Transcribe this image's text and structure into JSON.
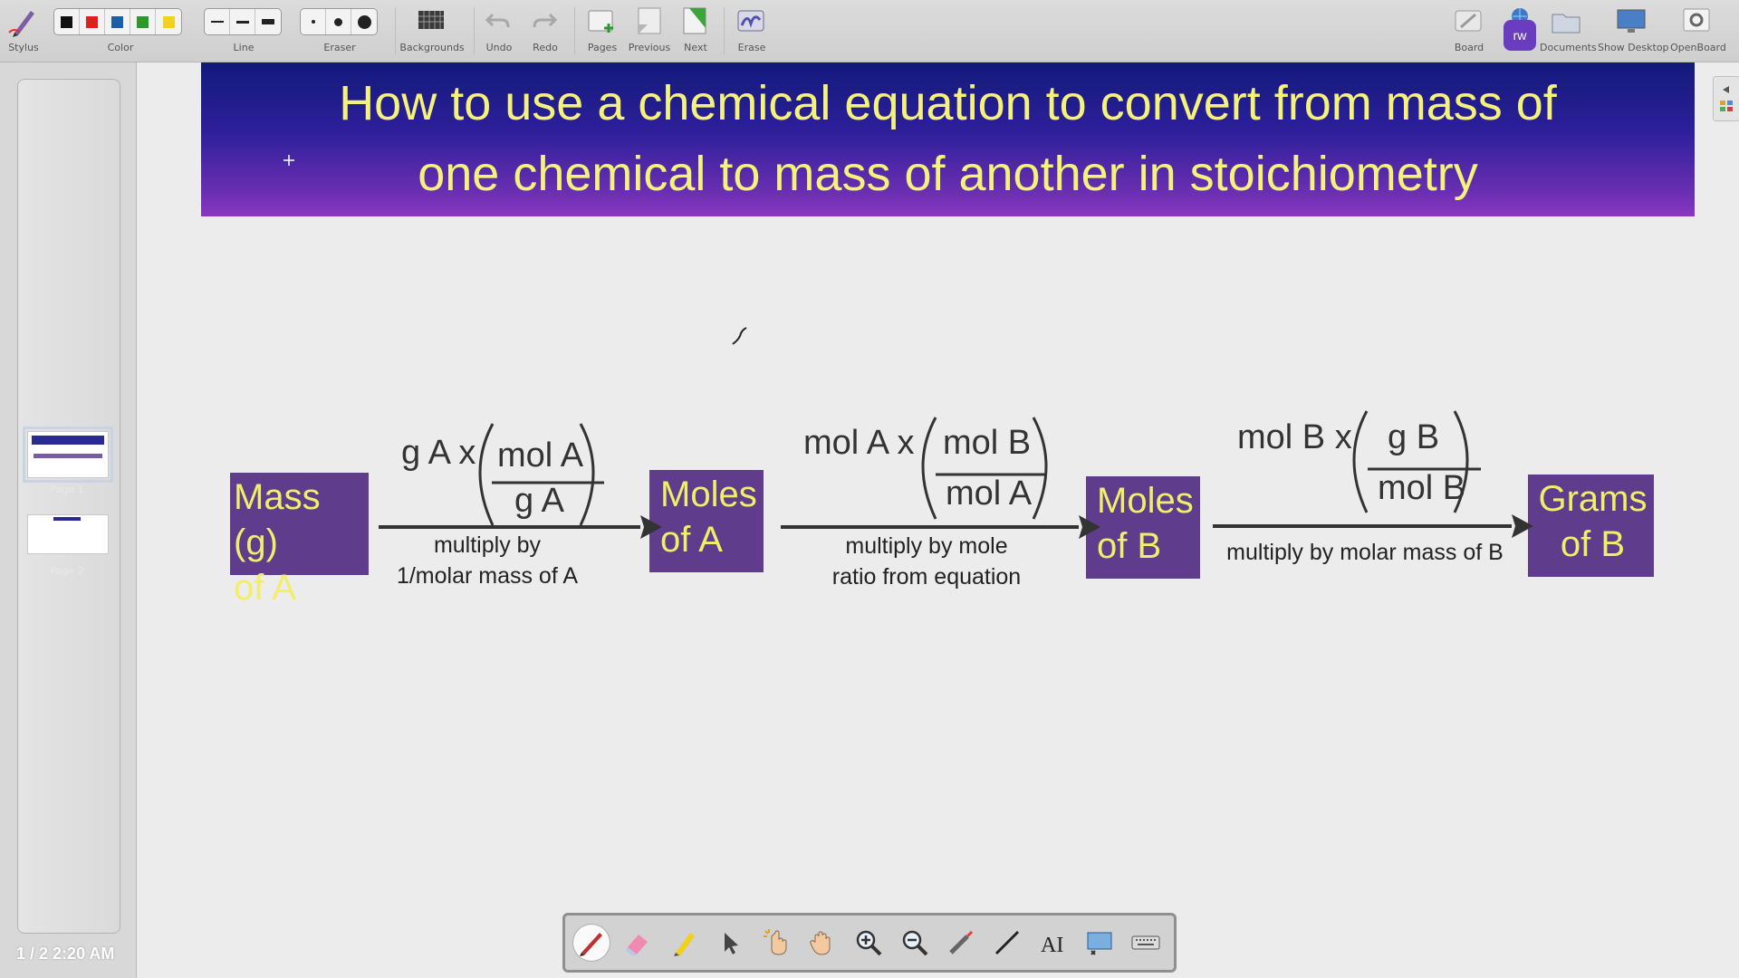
{
  "toolbar": {
    "stylus_label": "Stylus",
    "color_label": "Color",
    "line_label": "Line",
    "eraser_label": "Eraser",
    "backgrounds_label": "Backgrounds",
    "undo_label": "Undo",
    "redo_label": "Redo",
    "pages_label": "Pages",
    "previous_label": "Previous",
    "next_label": "Next",
    "erase_label": "Erase",
    "board_label": "Board",
    "documents_label": "Documents",
    "show_desktop_label": "Show Desktop",
    "openboard_label": "OpenBoard",
    "app_badge": "rw",
    "colors": [
      "#111111",
      "#e0201a",
      "#1c5fa8",
      "#2c9a2a",
      "#f3d21c"
    ],
    "selected_color_index": 1
  },
  "sidebar": {
    "thumbnails": [
      {
        "label": "Page 1"
      },
      {
        "label": "Page 2"
      }
    ],
    "page_counter": "1 / 2",
    "clock": "2:20 AM"
  },
  "slide": {
    "title_line1": "How to use a chemical equation to convert from mass of",
    "title_line2": "one chemical to mass of another in stoichiometry",
    "boxes": {
      "mass_a": [
        "Mass (g)",
        "of A"
      ],
      "moles_a": [
        "Moles",
        "of A"
      ],
      "moles_b": [
        "Moles",
        "of B"
      ],
      "grams_b": [
        "Grams",
        "of B"
      ]
    },
    "step1": {
      "prefix": "g A x",
      "numerator": "mol A",
      "denominator": "g A",
      "caption_line1": "multiply by",
      "caption_line2": "1/molar mass of A"
    },
    "step2": {
      "prefix": "mol A x",
      "numerator": "mol B",
      "denominator": "mol A",
      "caption_line1": "multiply by mole",
      "caption_line2": "ratio from equation"
    },
    "step3": {
      "prefix": "mol B x",
      "numerator": "g B",
      "denominator": "mol B",
      "caption_line1": "multiply by molar mass of B"
    }
  },
  "palette": {
    "tools": [
      "pen-icon",
      "eraser-icon",
      "highlighter-icon",
      "selector-icon",
      "interact-icon",
      "hand-icon",
      "zoom-in-icon",
      "zoom-out-icon",
      "laser-pointer-icon",
      "line-icon",
      "text-icon",
      "capture-icon",
      "keyboard-icon"
    ],
    "active_index": 0
  }
}
